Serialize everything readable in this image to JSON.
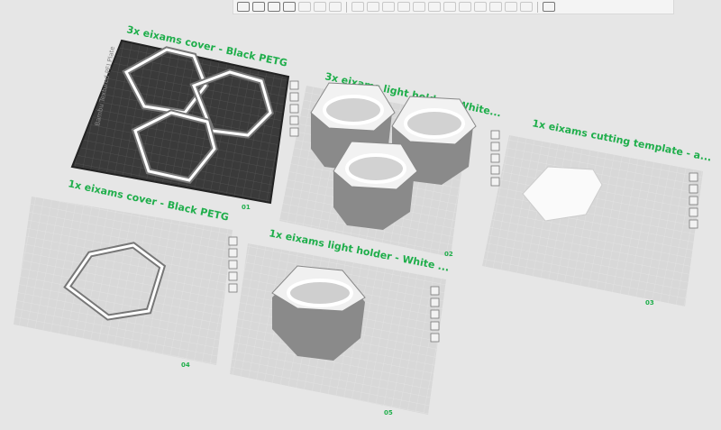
{
  "toolbar": {
    "buttons": [
      "add-plate",
      "auto-arrange-plate",
      "orient",
      "plate-settings",
      "copy",
      "paste",
      "delete",
      "move",
      "rotate",
      "scale",
      "cut",
      "split",
      "merge",
      "support-paint",
      "seam-paint",
      "color-paint",
      "text",
      "measure",
      "assembly",
      "layout-view"
    ]
  },
  "plates": [
    {
      "number": "01",
      "label": "3x eixams cover - Black PETG",
      "bed_text": "Bambu Textured PEI Plate"
    },
    {
      "number": "02",
      "label": "3x eixams light holder - White...",
      "bed_text": ""
    },
    {
      "number": "03",
      "label": "1x eixams cutting template - a...",
      "bed_text": ""
    },
    {
      "number": "04",
      "label": "1x eixams cover - Black PETG",
      "bed_text": ""
    },
    {
      "number": "05",
      "label": "1x eixams light holder - White ...",
      "bed_text": ""
    }
  ],
  "plate_buttons": [
    "close-plate",
    "auto-arrange",
    "orient-plate",
    "lock-plate",
    "plate-settings"
  ],
  "edit_icon": "✎",
  "colors": {
    "accent": "#1fae4b",
    "bed_dark": "#3a3a3a",
    "bed_light": "#d6d6d6"
  }
}
